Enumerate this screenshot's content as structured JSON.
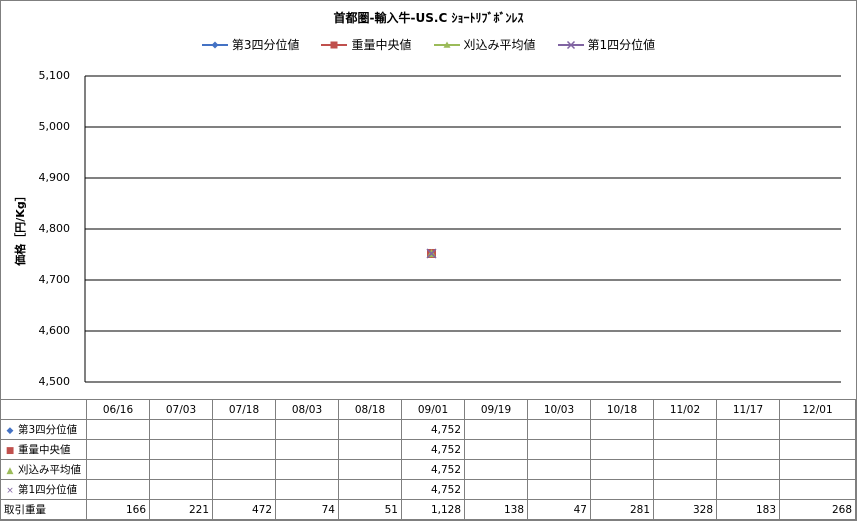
{
  "chart_data": {
    "type": "line",
    "title": "首都圏-輸入牛-US.C ｼｮｰﾄﾘﾌﾞﾎﾞﾝﾚｽ",
    "ylabel": "価格［円/Kg］",
    "xlabel": "",
    "ylim": [
      4500,
      5100
    ],
    "yticks": [
      "4,500",
      "4,600",
      "4,700",
      "4,800",
      "4,900",
      "5,000",
      "5,100"
    ],
    "ytick_values": [
      4500,
      4600,
      4700,
      4800,
      4900,
      5000,
      5100
    ],
    "categories": [
      "06/16",
      "07/03",
      "07/18",
      "08/03",
      "08/18",
      "09/01",
      "09/19",
      "10/03",
      "10/18",
      "11/02",
      "11/17",
      "12/01"
    ],
    "legend_position": "top",
    "grid": true,
    "series": [
      {
        "name": "第3四分位値",
        "color": "#4472c4",
        "marker": "diamond",
        "values": [
          null,
          null,
          null,
          null,
          null,
          4752,
          null,
          null,
          null,
          null,
          null,
          null
        ],
        "labels": [
          "",
          "",
          "",
          "",
          "",
          "4,752",
          "",
          "",
          "",
          "",
          "",
          ""
        ]
      },
      {
        "name": "重量中央値",
        "color": "#c0504d",
        "marker": "square",
        "values": [
          null,
          null,
          null,
          null,
          null,
          4752,
          null,
          null,
          null,
          null,
          null,
          null
        ],
        "labels": [
          "",
          "",
          "",
          "",
          "",
          "4,752",
          "",
          "",
          "",
          "",
          "",
          ""
        ]
      },
      {
        "name": "刈込み平均値",
        "color": "#9bbb59",
        "marker": "triangle",
        "values": [
          null,
          null,
          null,
          null,
          null,
          4752,
          null,
          null,
          null,
          null,
          null,
          null
        ],
        "labels": [
          "",
          "",
          "",
          "",
          "",
          "4,752",
          "",
          "",
          "",
          "",
          "",
          ""
        ]
      },
      {
        "name": "第1四分位値",
        "color": "#8064a2",
        "marker": "x",
        "values": [
          null,
          null,
          null,
          null,
          null,
          4752,
          null,
          null,
          null,
          null,
          null,
          null
        ],
        "labels": [
          "",
          "",
          "",
          "",
          "",
          "4,752",
          "",
          "",
          "",
          "",
          "",
          ""
        ]
      }
    ],
    "volume": {
      "name": "取引重量",
      "values": [
        166,
        221,
        472,
        74,
        51,
        1128,
        138,
        47,
        281,
        328,
        183,
        268
      ],
      "labels": [
        "166",
        "221",
        "472",
        "74",
        "51",
        "1,128",
        "138",
        "47",
        "281",
        "328",
        "183",
        "268"
      ]
    }
  }
}
